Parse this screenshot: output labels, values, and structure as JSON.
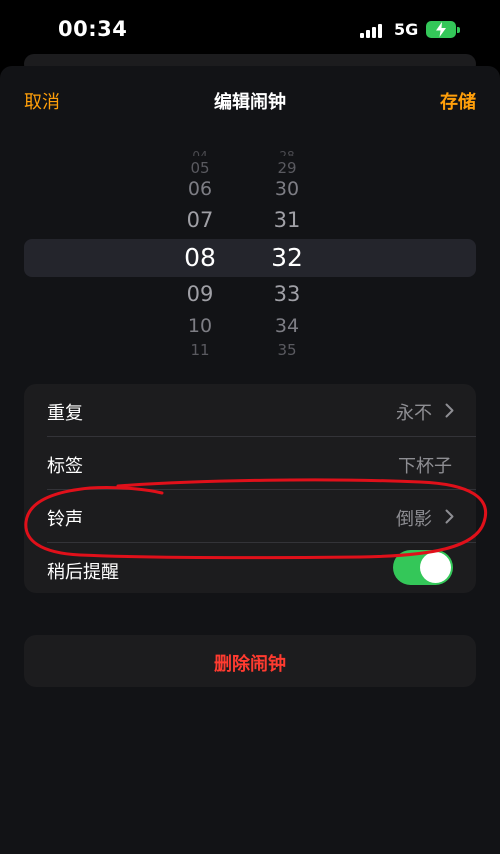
{
  "status_bar": {
    "time": "00:34",
    "network": "5G",
    "battery_charging": true,
    "icons": [
      "signal-icon",
      "battery-charging-icon"
    ]
  },
  "nav": {
    "cancel": "取消",
    "title": "编辑闹钟",
    "save": "存储"
  },
  "time_picker": {
    "hours": [
      "05",
      "06",
      "07",
      "08",
      "09",
      "10",
      "11"
    ],
    "minutes": [
      "29",
      "30",
      "31",
      "32",
      "33",
      "34",
      "35"
    ],
    "selected_hour": "08",
    "selected_minute": "32"
  },
  "settings": {
    "repeat": {
      "label": "重复",
      "value": "永不"
    },
    "label": {
      "label": "标签",
      "value": "下杯子"
    },
    "sound": {
      "label": "铃声",
      "value": "倒影"
    },
    "snooze": {
      "label": "稍后提醒",
      "on": true
    }
  },
  "delete_button": "删除闹钟",
  "colors": {
    "accent": "#ff9f0a",
    "destructive": "#ff3b30",
    "toggle_on": "#34c759",
    "annotation": "#e0101a"
  }
}
